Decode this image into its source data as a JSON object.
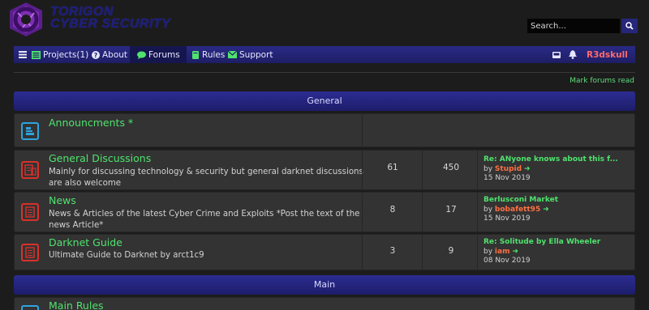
{
  "header": {
    "logo_line1": "TORIGON",
    "logo_line2": "CYBER SECURITY",
    "search_placeholder": "Search..."
  },
  "navbar": {
    "projects": "Projects(1)",
    "about": "About",
    "forums": "Forums",
    "rules": "Rules",
    "support": "Support",
    "username": "R3dskull"
  },
  "mark_forums_read": "Mark forums read",
  "categories": [
    {
      "name": "General"
    },
    {
      "name": "Main"
    }
  ],
  "forums": [
    {
      "title": "Announcments *",
      "desc": "",
      "topics": "",
      "posts": ""
    },
    {
      "title": "General Discussions",
      "desc": "Mainly for discussing technology & security but general darknet discussions are also welcome",
      "topics": "61",
      "posts": "450",
      "last_title": "Re: ANyone knows about this f...",
      "last_by": "by",
      "last_user": "Stupid",
      "last_date": "15 Nov 2019"
    },
    {
      "title": "News",
      "desc": "News & Articles of the latest Cyber Crime and Exploits *Post the text of the news Article*",
      "topics": "8",
      "posts": "17",
      "last_title": "Berlusconi Market",
      "last_by": "by",
      "last_user": "bobafett95",
      "last_date": "15 Nov 2019"
    },
    {
      "title": "Darknet Guide",
      "desc": "Ultimate Guide to Darknet by arct1c9",
      "topics": "3",
      "posts": "9",
      "last_title": "Re: Solitude by Ella Wheeler",
      "last_by": "by",
      "last_user": "iam",
      "last_date": "08 Nov 2019"
    },
    {
      "title": "Main Rules"
    }
  ],
  "colors": {
    "accent": "#2a2a86",
    "link_green": "#4fe36d",
    "user_orange": "#ff7043",
    "username_red": "#ff6b6b"
  }
}
